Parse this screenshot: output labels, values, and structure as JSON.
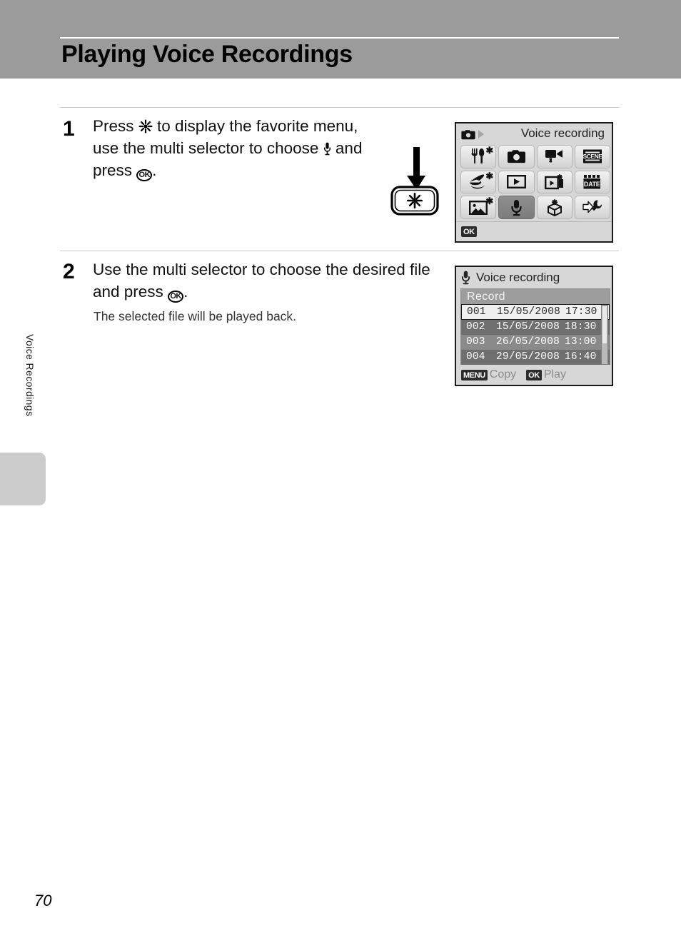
{
  "header": {
    "title": "Playing Voice Recordings"
  },
  "side_tab": {
    "label": "Voice Recordings"
  },
  "footer": {
    "page_number": "70"
  },
  "steps": [
    {
      "number": "1",
      "text_before_star": "Press ",
      "text_after_star": " to display the favorite menu, use the multi selector to choose ",
      "text_after_mic": " and press ",
      "text_end": ".",
      "ok_label": "OK"
    },
    {
      "number": "2",
      "text_before_ok": "Use the multi selector to choose the desired file and press ",
      "ok_label": "OK",
      "text_end": ".",
      "note": "The selected file will be played back."
    }
  ],
  "button_illustration": {
    "button_glyph": "asterisk-glyph",
    "arrow": "down-arrow"
  },
  "menu_screen": {
    "mode_icon": "camera-icon",
    "title": "Voice recording",
    "ok_badge": "OK",
    "cells": [
      {
        "icon": "restaurant-icon",
        "starred": true,
        "selected": false
      },
      {
        "icon": "camera-icon",
        "starred": false,
        "selected": false
      },
      {
        "icon": "movie-icon",
        "starred": false,
        "selected": false
      },
      {
        "icon": "scene-icon",
        "starred": false,
        "selected": false,
        "label": "SCENE"
      },
      {
        "icon": "travel-hat-icon",
        "starred": true,
        "selected": false
      },
      {
        "icon": "playback-icon",
        "starred": false,
        "selected": false
      },
      {
        "icon": "slideshow-icon",
        "starred": false,
        "selected": false
      },
      {
        "icon": "date-icon",
        "starred": false,
        "selected": false,
        "label": "DATE"
      },
      {
        "icon": "landscape-icon",
        "starred": true,
        "selected": false
      },
      {
        "icon": "microphone-icon",
        "starred": false,
        "selected": true
      },
      {
        "icon": "package-icon",
        "starred": false,
        "selected": false
      },
      {
        "icon": "setup-wrench-icon",
        "starred": false,
        "selected": false
      }
    ]
  },
  "list_screen": {
    "header_icon": "microphone-icon",
    "title": "Voice recording",
    "subheader": "Record",
    "columns": [
      "no",
      "date",
      "time"
    ],
    "rows": [
      {
        "no": "001",
        "date": "15/05/2008",
        "time": "17:30",
        "selected": true
      },
      {
        "no": "002",
        "date": "15/05/2008",
        "time": "18:30",
        "selected": false
      },
      {
        "no": "003",
        "date": "26/05/2008",
        "time": "13:00",
        "selected": false
      },
      {
        "no": "004",
        "date": "29/05/2008",
        "time": "16:40",
        "selected": false
      }
    ],
    "footer": {
      "menu_badge": "MENU",
      "menu_label": "Copy",
      "ok_badge": "OK",
      "ok_label": "Play"
    }
  }
}
